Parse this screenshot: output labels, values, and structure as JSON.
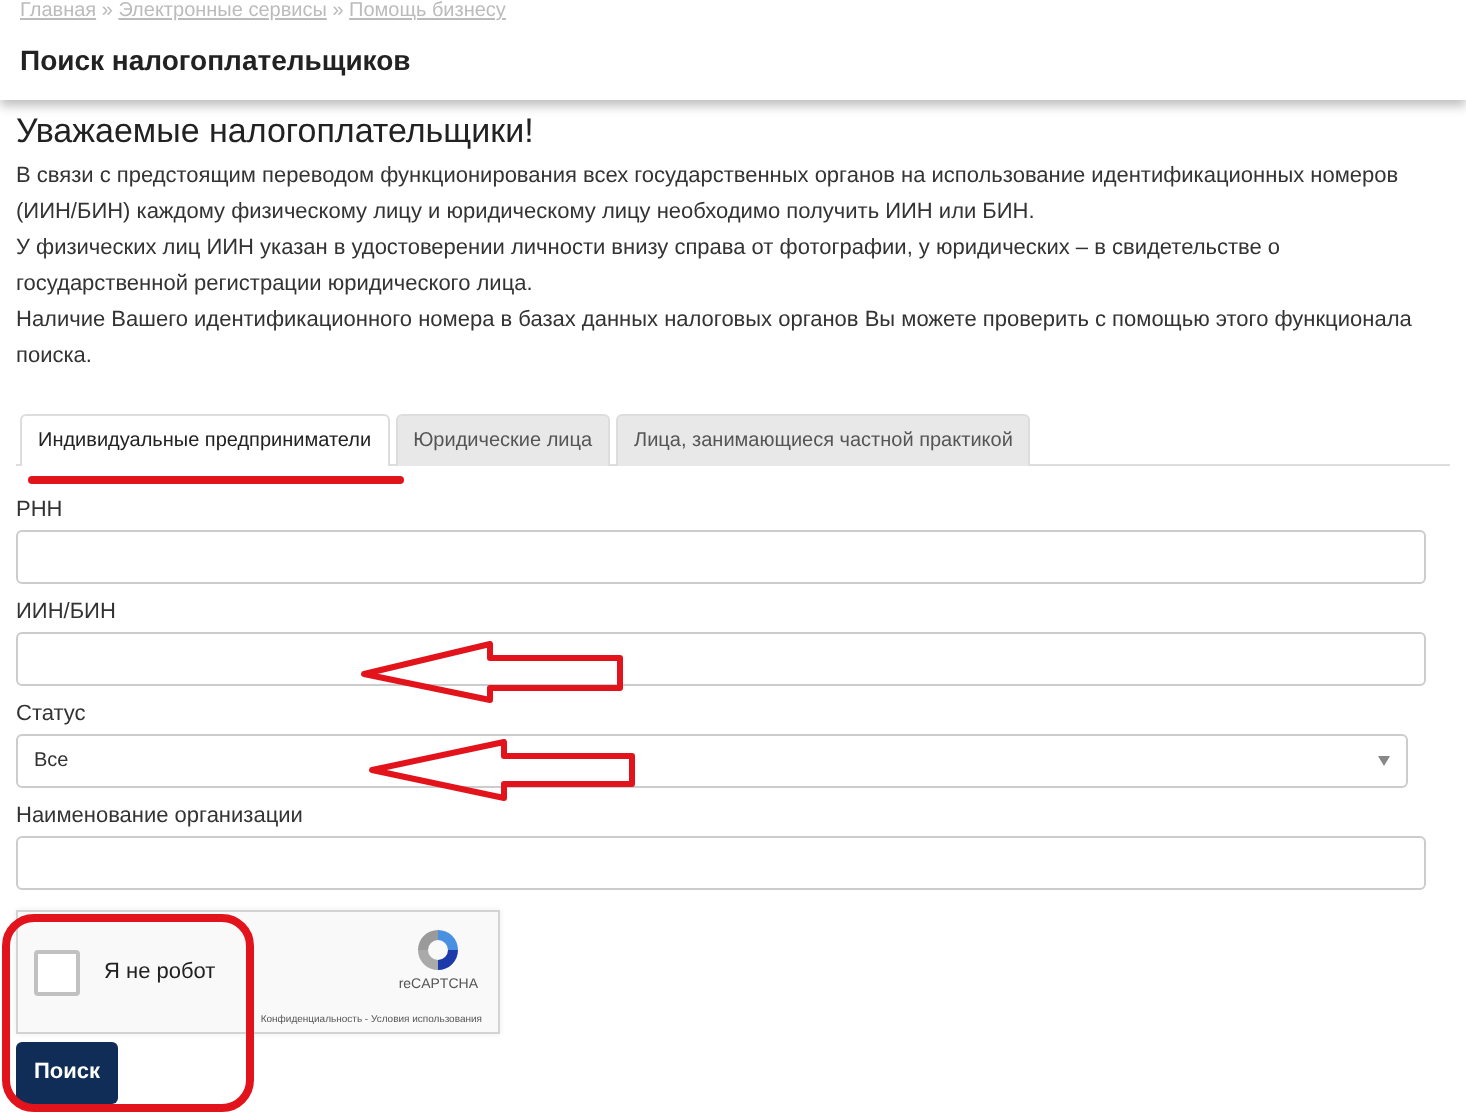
{
  "breadcrumb": {
    "separator": "»",
    "items": [
      "Главная",
      "Электронные сервисы",
      "Помощь бизнесу"
    ]
  },
  "page_title": "Поиск налогоплательщиков",
  "intro": {
    "heading": "Уважаемые налогоплательщики!",
    "paragraphs": [
      "В связи с предстоящим переводом функционирования всех государственных органов на использование идентификационных номеров (ИИН/БИН) каждому физическому лицу и юридическому лицу необходимо получить ИИН или БИН.",
      "У физических лиц ИИН указан в удостоверении личности внизу справа от фотографии, у юридических – в свидетельстве о государственной регистрации юридического лица.",
      "Наличие Вашего идентификационного номера в базах данных налоговых органов Вы можете проверить с помощью этого функционала поиска."
    ]
  },
  "tabs": [
    {
      "label": "Индивидуальные предприниматели",
      "selected": true
    },
    {
      "label": "Юридические лица",
      "selected": false
    },
    {
      "label": "Лица, занимающиеся частной практикой",
      "selected": false
    }
  ],
  "fields": [
    {
      "label": "РНН",
      "kind": "text"
    },
    {
      "label": "ИИН/БИН",
      "kind": "text"
    },
    {
      "label": "Статус",
      "kind": "select",
      "value": "Все"
    },
    {
      "label": "Наименование организации",
      "kind": "text"
    }
  ],
  "captcha": {
    "label": "Я не робот",
    "checked": false,
    "brand": "reCAPTCHA",
    "footer": "Конфиденциальность - Условия использования"
  },
  "submit": "Поиск"
}
